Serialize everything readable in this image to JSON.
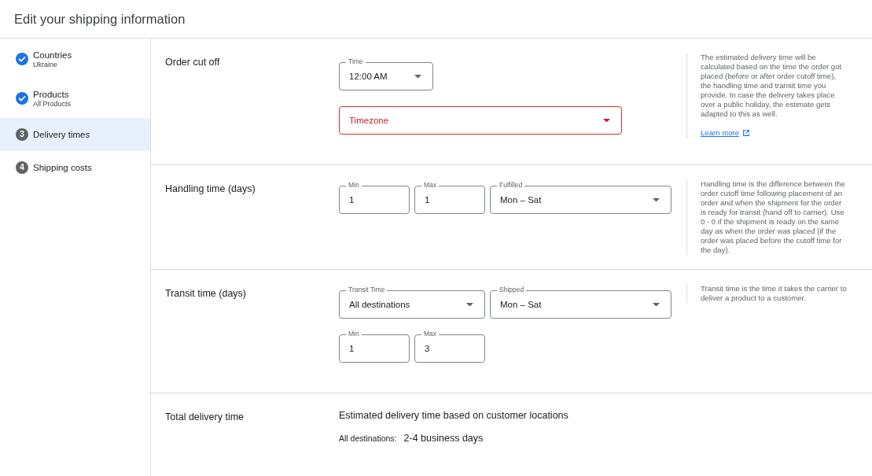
{
  "header": {
    "title": "Edit your shipping information"
  },
  "steps": [
    {
      "kind": "done",
      "label": "Countries",
      "sublabel": "Ukraine",
      "selected": false
    },
    {
      "kind": "done",
      "label": "Products",
      "sublabel": "All Products",
      "selected": false
    },
    {
      "kind": "numbered",
      "number": "3",
      "label": "Delivery times",
      "selected": true
    },
    {
      "kind": "numbered",
      "number": "4",
      "label": "Shipping costs",
      "selected": false
    }
  ],
  "sections": [
    {
      "kind": "form",
      "title": "Order cut off",
      "rows": [
        [
          {
            "kind": "select",
            "label": "Time",
            "value": "12:00 AM",
            "error": false
          }
        ],
        [
          {
            "kind": "select",
            "placeholder": "Timezone",
            "error": true
          }
        ]
      ],
      "help": {
        "text": "The estimated delivery time will be calculated based on the time the order got placed (before or after order cutoff time), the handling time and transit time you provide. In case the delivery takes place over a public holiday, the estimate gets adapted to this as well.",
        "link": "Learn more"
      }
    },
    {
      "kind": "form",
      "title": "Handling time (days)",
      "rows": [
        [
          {
            "kind": "input",
            "label": "Min",
            "value": "1",
            "error": false
          },
          {
            "kind": "input",
            "label": "Max",
            "value": "1",
            "error": false
          },
          {
            "kind": "select",
            "label": "Fulfilled",
            "value": "Mon – Sat",
            "error": false
          }
        ]
      ],
      "help": {
        "text": "Handling time is the difference between the order cutoff time following placement of an order and when the shipment for the order is ready for transit (hand off to carrier). Use 0 - 0 if the shipment is ready on the same day as when the order was placed (if the order was placed before the cutoff time for the day)."
      }
    },
    {
      "kind": "form",
      "title": "Transit time (days)",
      "rows": [
        [
          {
            "kind": "select",
            "label": "Transit Time",
            "value": "All destinations",
            "error": false
          },
          {
            "kind": "select",
            "label": "Shipped",
            "value": "Mon – Sat",
            "error": false
          }
        ],
        [
          {
            "kind": "input",
            "label": "Min",
            "value": "1",
            "error": false
          },
          {
            "kind": "input",
            "label": "Max",
            "value": "3",
            "error": false
          }
        ]
      ],
      "help": {
        "text": "Transit time is the time it takes the carrier to deliver a product to a customer."
      }
    },
    {
      "kind": "summary",
      "title": "Total delivery time",
      "heading": "Estimated delivery time based on customer locations",
      "items": [
        {
          "label": "All destinations:",
          "value": "2-4 business days"
        }
      ]
    }
  ]
}
